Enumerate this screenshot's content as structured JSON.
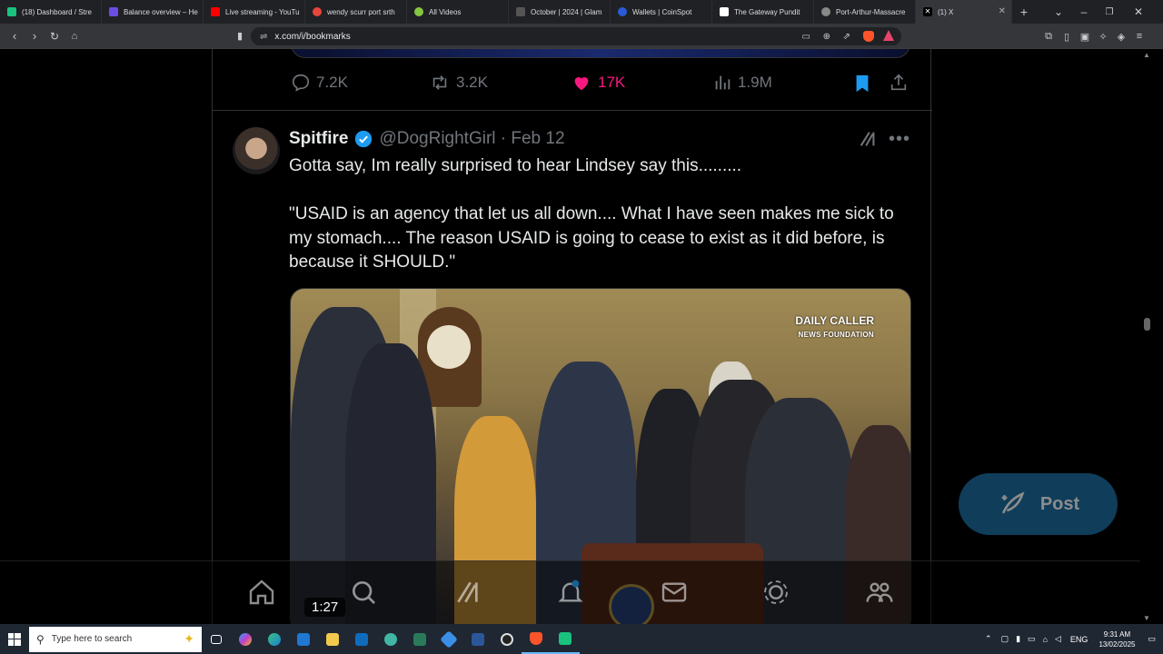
{
  "browser": {
    "tabs": [
      {
        "label": "(18) Dashboard / Stre",
        "color": "#19c37d"
      },
      {
        "label": "Balance overview – He",
        "color": "#6b4ce6"
      },
      {
        "label": "Live streaming - YouTu",
        "color": "#ff0000"
      },
      {
        "label": "wendy scurr port srth",
        "color": "#e8453c"
      },
      {
        "label": "All Videos",
        "color": "#85c742"
      },
      {
        "label": "October | 2024 | Glam",
        "color": "#555555"
      },
      {
        "label": "Wallets | CoinSpot",
        "color": "#2a5bd7"
      },
      {
        "label": "The Gateway Pundit",
        "color": "#ffffff"
      },
      {
        "label": "Port-Arthur-Massacre",
        "color": "#888888"
      },
      {
        "label": "(1) X",
        "color": "#000000",
        "active": true
      }
    ],
    "url": "x.com/i/bookmarks"
  },
  "previous_post": {
    "replies": "7.2K",
    "reposts": "3.2K",
    "likes": "17K",
    "views": "1.9M"
  },
  "post": {
    "author_name": "Spitfire",
    "handle_date": "@DogRightGirl · Feb 12",
    "text": "Gotta say, Im really surprised to hear Lindsey say this.........\n\n\"USAID is an agency that let us all down.... What I have seen makes me sick to my stomach.... The reason USAID is going to cease to exist as it did before, is because it SHOULD.\"",
    "watermark_line1": "DAILY CALLER",
    "watermark_line2": "NEWS FOUNDATION",
    "video_duration": "1:27"
  },
  "post_button": "Post",
  "taskbar": {
    "search_placeholder": "Type here to search",
    "language": "ENG",
    "time": "9:31 AM",
    "date": "13/02/2025"
  },
  "colors": {
    "like": "#f91880",
    "bookmark": "#1d9bf0",
    "verified": "#1d9bf0"
  }
}
